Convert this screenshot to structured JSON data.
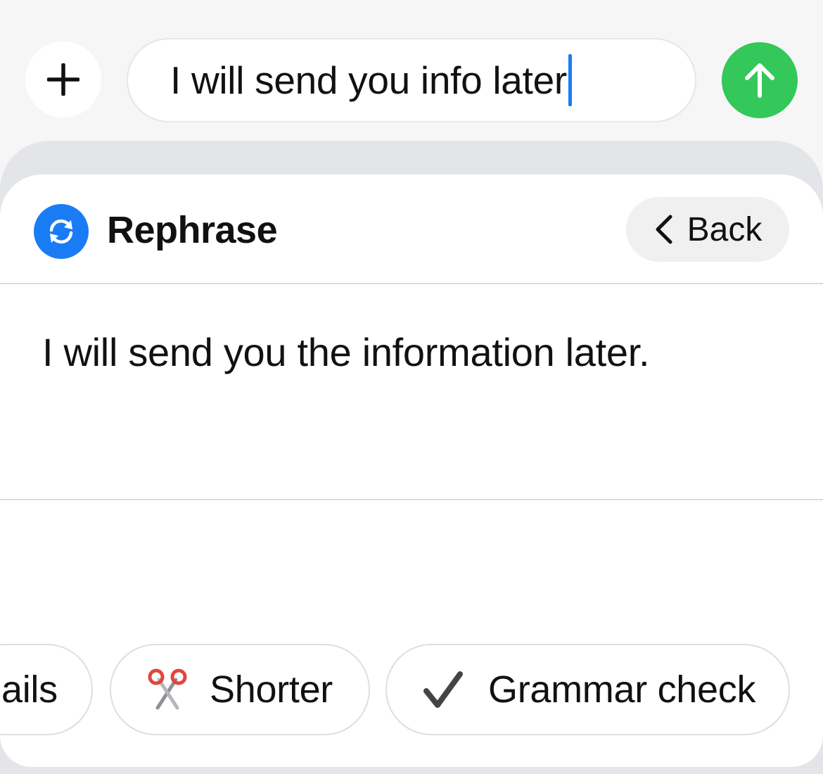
{
  "composer": {
    "add_icon": "plus-icon",
    "message_text": "I will send you info later",
    "send_icon": "arrow-up-icon",
    "send_color": "#34c759"
  },
  "panel": {
    "title": "Rephrase",
    "title_icon": "rephrase-cycle-icon",
    "icon_color": "#1a7cf5",
    "back_label": "Back",
    "back_icon": "chevron-left-icon",
    "result": "I will send you the information later."
  },
  "chips": {
    "details_partial": "ails",
    "shorter_label": "Shorter",
    "shorter_icon": "scissors-icon",
    "grammar_label": "Grammar check",
    "grammar_icon": "checkmark-icon"
  }
}
